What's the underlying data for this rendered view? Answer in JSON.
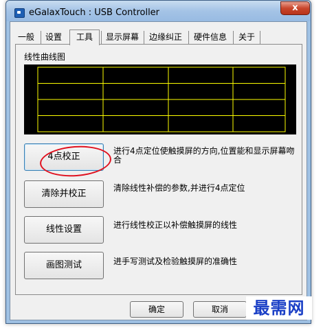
{
  "window": {
    "title": "eGalaxTouch : USB Controller",
    "close_glyph": "x"
  },
  "tabs": [
    {
      "label": "一般",
      "active": false
    },
    {
      "label": "设置",
      "active": false
    },
    {
      "label": "工具",
      "active": true
    },
    {
      "label": "显示屏幕",
      "active": false
    },
    {
      "label": "边缘纠正",
      "active": false
    },
    {
      "label": "硬件信息",
      "active": false
    },
    {
      "label": "关于",
      "active": false
    }
  ],
  "linearity": {
    "label": "线性曲线图",
    "grid": {
      "rows": 4,
      "cols": 4,
      "line_color": "#ffff00",
      "background": "#000000"
    }
  },
  "tools": [
    {
      "button": "4点校正",
      "description": "进行4点定位使触摸屏的方向,位置能和显示屏幕吻合"
    },
    {
      "button": "清除并校正",
      "description": "清除线性补偿的参数,并进行4点定位"
    },
    {
      "button": "线性设置",
      "description": "进行线性校正以补偿触摸屏的线性"
    },
    {
      "button": "画图测试",
      "description": "进手写测试及检验触摸屏的准确性"
    }
  ],
  "footer": {
    "ok_label": "确定",
    "cancel_label": "取消"
  },
  "annotation": {
    "highlight_color": "#e0101e"
  },
  "watermark": {
    "text": "最需网",
    "color": "#1a3fc6"
  }
}
